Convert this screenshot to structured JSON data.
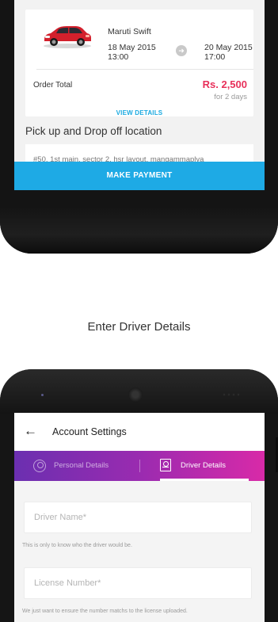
{
  "top_screen": {
    "order": {
      "car_name": "Maruti Swift",
      "pickup_date": "18 May 2015",
      "pickup_time": "13:00",
      "dropoff_date": "20 May 2015",
      "dropoff_time": "17:00",
      "arrow_icon": "arrow-right-icon",
      "total_label": "Order Total",
      "total_value": "Rs. 2,500",
      "total_duration": "for 2 days",
      "view_details_label": "VIEW DETAILS",
      "price_color": "#e8305a",
      "link_color": "#1aa9e0"
    },
    "pickup_section_label": "Pick up and Drop off location",
    "address_snippet": "#50, 1st main, sector 2, hsr layout, mangammaplya",
    "make_payment_label": "MAKE PAYMENT",
    "make_payment_color": "#1eaae5"
  },
  "caption": "Enter Driver Details",
  "bottom_screen": {
    "header": {
      "back_icon": "back-arrow-icon",
      "title": "Account Settings"
    },
    "tabs": [
      {
        "label": "Personal Details",
        "icon": "person-icon",
        "active": false
      },
      {
        "label": "Driver Details",
        "icon": "id-card-icon",
        "active": true
      }
    ],
    "tab_gradient": [
      "#6b2fb0",
      "#d82aa8"
    ],
    "form": {
      "driver_name_placeholder": "Driver Name*",
      "driver_name_helper": "This is only to know who the driver would be.",
      "license_placeholder": "License Number*",
      "license_helper": "We just want to ensure the number matchs to the license uploaded."
    }
  }
}
